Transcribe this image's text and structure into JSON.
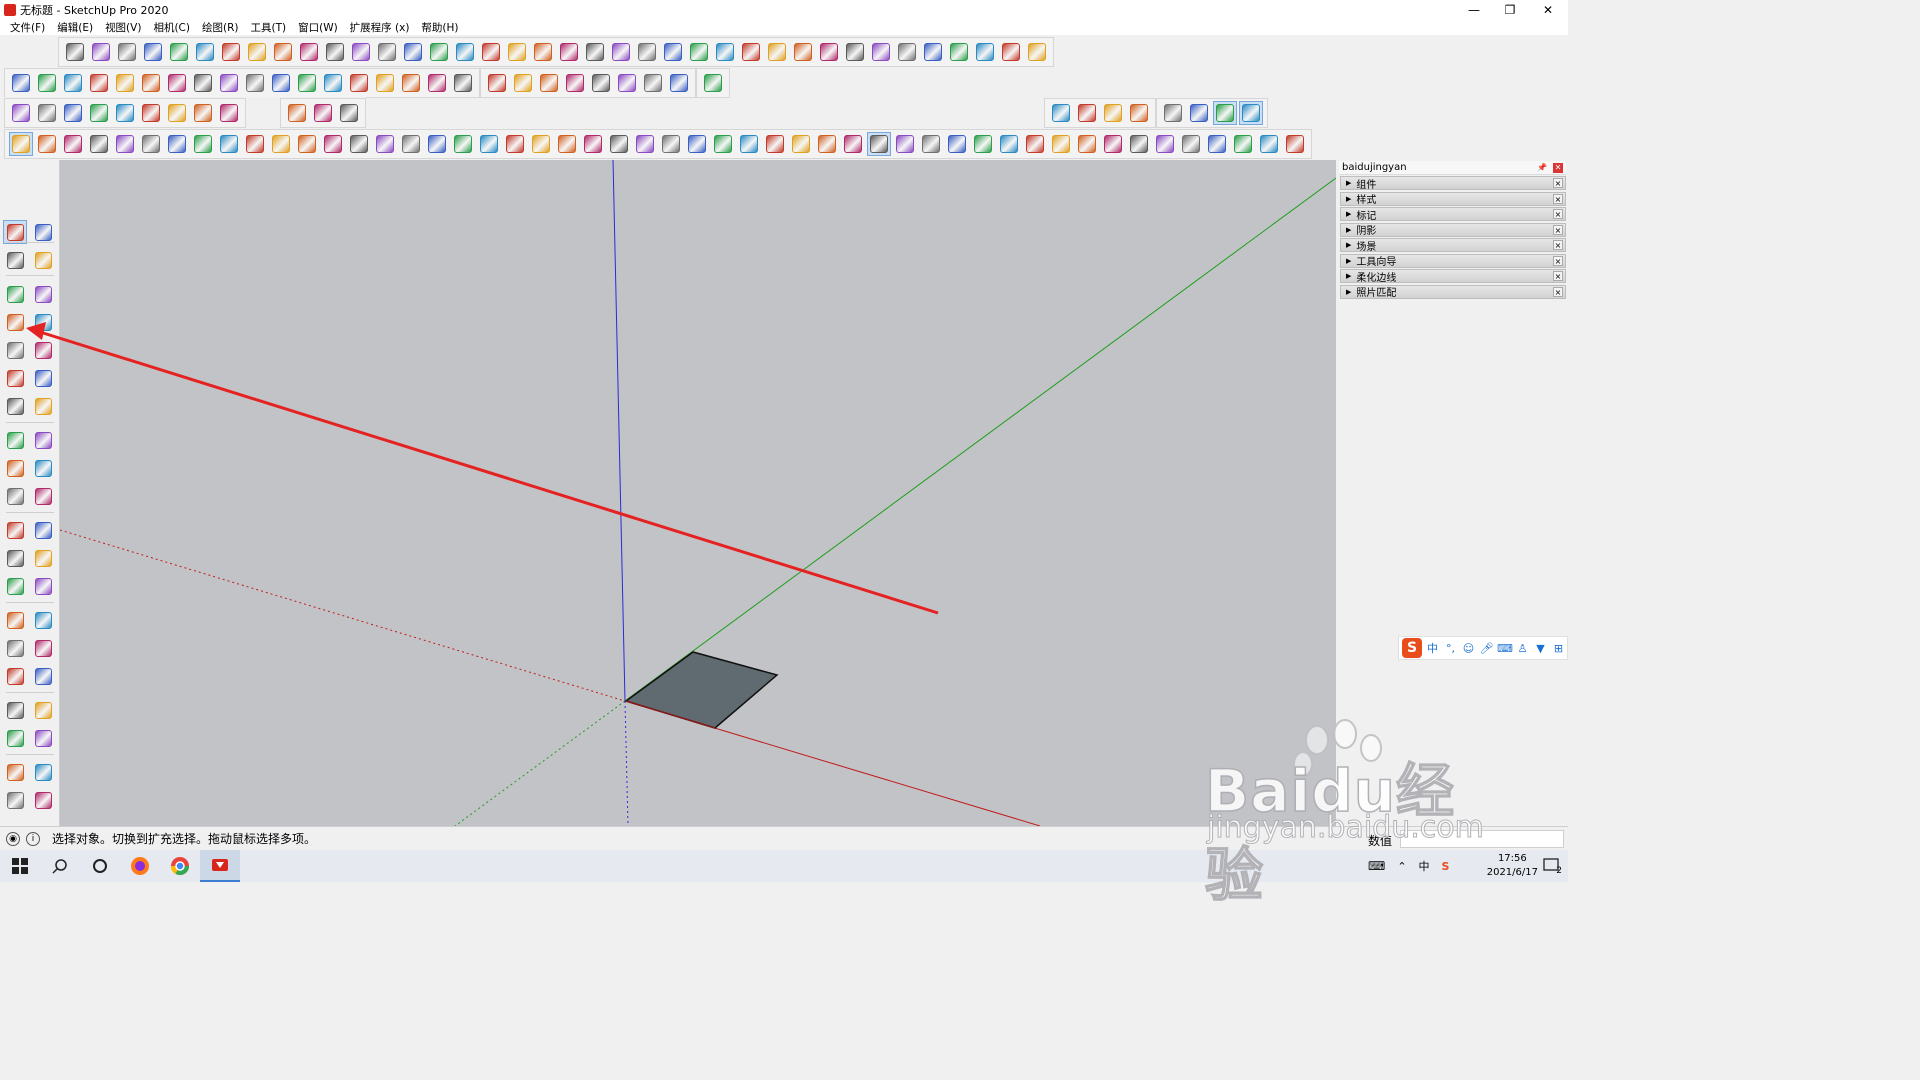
{
  "window": {
    "title": "无标题 - SketchUp Pro 2020",
    "minimize_glyph": "—",
    "restore_glyph": "❐",
    "close_glyph": "✕"
  },
  "menu": [
    "文件(F)",
    "编辑(E)",
    "视图(V)",
    "相机(C)",
    "绘图(R)",
    "工具(T)",
    "窗口(W)",
    "扩展程序 (x)",
    "帮助(H)"
  ],
  "tray": {
    "title": "baidujingyan",
    "close_glyph": "✕",
    "panels": [
      "组件",
      "样式",
      "标记",
      "阴影",
      "场景",
      "工具向导",
      "柔化边线",
      "照片匹配"
    ]
  },
  "text_tool_icon": "A1",
  "status": {
    "message": "选择对象。切换到扩充选择。拖动鼠标选择多项。",
    "measurements_label": "数值",
    "measurements_value": ""
  },
  "ime": {
    "logo": "S",
    "chinese_mode": "中",
    "punct": "°,",
    "icons": [
      "smile-icon",
      "mic-icon",
      "keyboard-icon",
      "user-icon",
      "shirt-icon",
      "grid-icon"
    ]
  },
  "taskbar": {
    "time": "17:56",
    "date": "2021/6/17",
    "notif_count": "2"
  },
  "watermark": {
    "brand": "Baidu",
    "brand_cn": "经验",
    "url": "jingyan.baidu.com"
  },
  "colors": {
    "viewport_bg": "#c2c3c7",
    "axis_blue": "#2b2bd6",
    "axis_green": "#1e9e1e",
    "axis_red": "#c01c1c",
    "face": "#5f6b70",
    "annotation_arrow": "#e52222",
    "toolbar_bg": "#f0f0f0"
  }
}
